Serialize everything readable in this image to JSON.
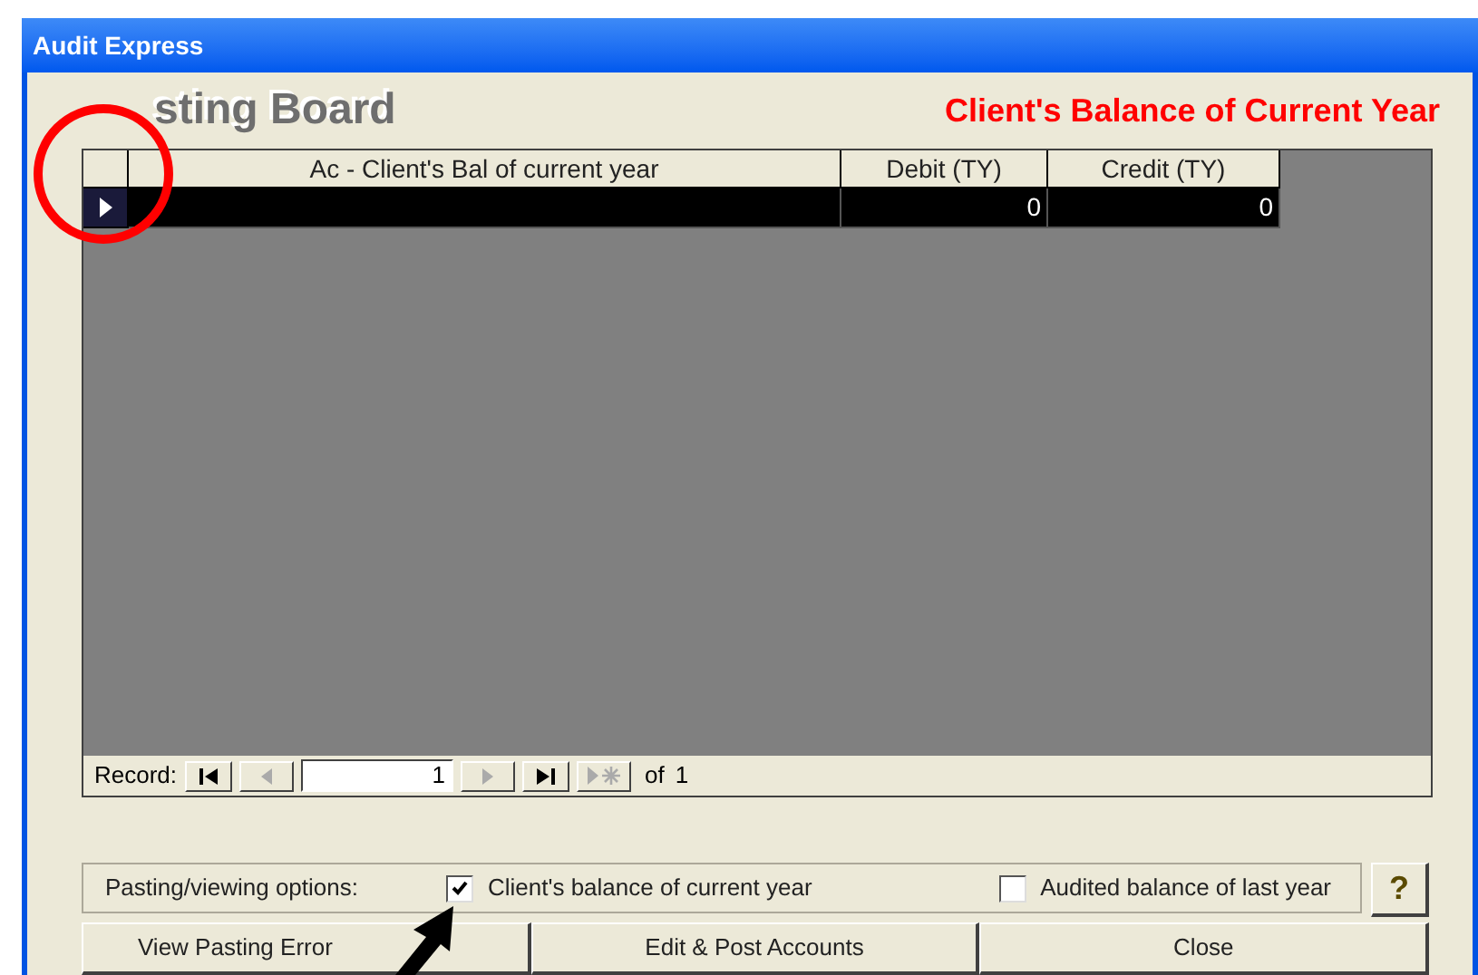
{
  "window": {
    "title": "Audit Express"
  },
  "form": {
    "heading": "sting Board",
    "subtitle": "Client's Balance of Current Year"
  },
  "table": {
    "columns": [
      "Ac - Client's Bal of current year",
      "Debit (TY)",
      "Credit (TY)"
    ],
    "rows": [
      {
        "selected": true,
        "cells": [
          "",
          "0",
          "0"
        ]
      }
    ]
  },
  "navigator": {
    "label": "Record:",
    "current": "1",
    "of_label": "of",
    "total": "1"
  },
  "options": {
    "label": "Pasting/viewing options:",
    "checkboxes": [
      {
        "label": "Client's balance of current year",
        "checked": true
      },
      {
        "label": "Audited balance of last year",
        "checked": false
      }
    ],
    "help": "?"
  },
  "buttons": [
    {
      "label": "View Pasting Error"
    },
    {
      "label": "Edit & Post Accounts"
    },
    {
      "label": "Close"
    }
  ]
}
